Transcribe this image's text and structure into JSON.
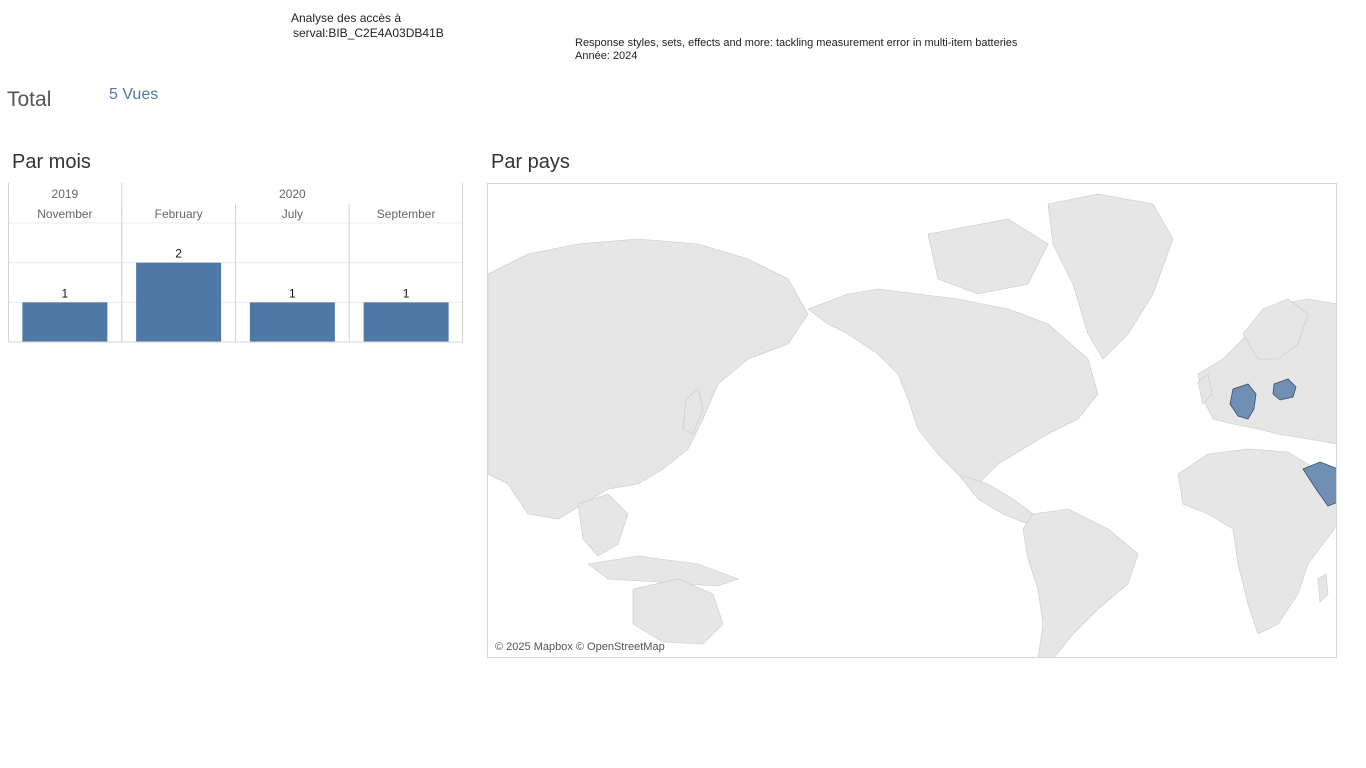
{
  "header": {
    "title_line1": "Analyse des accès à",
    "title_line2": "serval:BIB_C2E4A03DB41B",
    "doc_title": "Response styles, sets, effects and more: tackling measurement error in multi-item batteries",
    "doc_year": "Année: 2024"
  },
  "total": {
    "label": "Total",
    "value": "5 Vues"
  },
  "sections": {
    "months_title": "Par mois",
    "country_title": "Par pays"
  },
  "chart_data": {
    "type": "bar",
    "years": [
      {
        "label": "2019",
        "span": 1
      },
      {
        "label": "2020",
        "span": 3
      }
    ],
    "categories": [
      "November",
      "February",
      "July",
      "September"
    ],
    "values": [
      1,
      2,
      1,
      1
    ],
    "ylim": [
      0,
      3
    ],
    "grid": true,
    "colors": {
      "bar": "#4e79a7"
    }
  },
  "map": {
    "credit": "© 2025 Mapbox © OpenStreetMap",
    "highlighted_countries": [
      "Germany",
      "Belarus",
      "Saudi Arabia"
    ],
    "colors": {
      "land": "#e6e6e6",
      "water": "#ffffff",
      "highlight": "#4e79a7"
    }
  }
}
